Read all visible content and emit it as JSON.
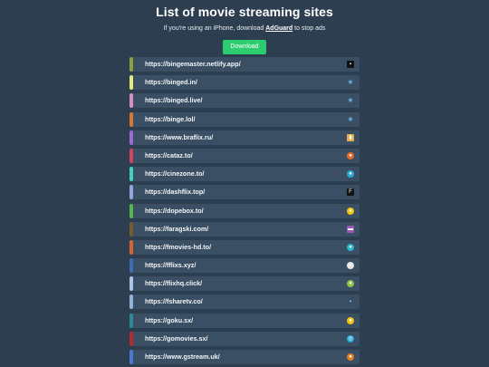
{
  "header": {
    "title": "List of movie streaming sites",
    "subtitle_prefix": "If you're using an iPhone, download ",
    "subtitle_link": "AdGuard",
    "subtitle_suffix": " to stop ads",
    "download_label": "Download"
  },
  "colors": {
    "background": "#2d3e50",
    "item_background": "#3a4f63",
    "download_button": "#2ecc71"
  },
  "sites": [
    {
      "url": "https://bingemaster.netlify.app/",
      "accent": "#8ea13a",
      "icon": "film-icon",
      "icon_bg": "#111111",
      "icon_glyph": "▪",
      "icon_shape": "square"
    },
    {
      "url": "https://binged.in/",
      "accent": "#e6e87a",
      "icon": "star-icon",
      "icon_bg": "transparent",
      "icon_glyph": "★",
      "icon_shape": "square"
    },
    {
      "url": "https://binged.live/",
      "accent": "#d98cc7",
      "icon": "star-icon",
      "icon_bg": "transparent",
      "icon_glyph": "★",
      "icon_shape": "square"
    },
    {
      "url": "https://binge.lol/",
      "accent": "#d9772e",
      "icon": "star-icon",
      "icon_bg": "transparent",
      "icon_glyph": "★",
      "icon_shape": "square"
    },
    {
      "url": "https://www.braflix.ru/",
      "accent": "#9b6ad6",
      "icon": "popcorn-icon",
      "icon_bg": "#e8b04a",
      "icon_glyph": "▮",
      "icon_shape": "square"
    },
    {
      "url": "https://cataz.to/",
      "accent": "#d6425f",
      "icon": "cataz-icon",
      "icon_bg": "#e86a2a",
      "icon_glyph": "●",
      "icon_shape": "round"
    },
    {
      "url": "https://cinezone.to/",
      "accent": "#3fd1c4",
      "icon": "cinezone-icon",
      "icon_bg": "#2aa8d6",
      "icon_glyph": "●",
      "icon_shape": "round"
    },
    {
      "url": "https://dashflix.top/",
      "accent": "#8fa6e0",
      "icon": "dashflix-icon",
      "icon_bg": "#111111",
      "icon_glyph": "F",
      "icon_shape": "square"
    },
    {
      "url": "https://dopebox.to/",
      "accent": "#52b84a",
      "icon": "dopebox-icon",
      "icon_bg": "#f1c40f",
      "icon_glyph": "●",
      "icon_shape": "round"
    },
    {
      "url": "https://faragski.com/",
      "accent": "#7a5a2a",
      "icon": "faragski-icon",
      "icon_bg": "#9b59b6",
      "icon_glyph": "▬",
      "icon_shape": "square"
    },
    {
      "url": "https://fmovies-hd.to/",
      "accent": "#d9622e",
      "icon": "fmovies-icon",
      "icon_bg": "#28b4d0",
      "icon_glyph": "●",
      "icon_shape": "round"
    },
    {
      "url": "https://fflixs.xyz/",
      "accent": "#3a6fb8",
      "icon": "fflixs-icon",
      "icon_bg": "#e8e8e8",
      "icon_glyph": "◐",
      "icon_shape": "round"
    },
    {
      "url": "https://flixhq.click/",
      "accent": "#a9c6e8",
      "icon": "flixhq-icon",
      "icon_bg": "#8bc34a",
      "icon_glyph": "●",
      "icon_shape": "round"
    },
    {
      "url": "https://fsharetv.co/",
      "accent": "#8fb3d9",
      "icon": "fsharetv-icon",
      "icon_bg": "transparent",
      "icon_glyph": "•",
      "icon_shape": "round"
    },
    {
      "url": "https://goku.sx/",
      "accent": "#2a8a9a",
      "icon": "goku-icon",
      "icon_bg": "#f1c40f",
      "icon_glyph": "●",
      "icon_shape": "round"
    },
    {
      "url": "https://gomovies.sx/",
      "accent": "#b82a2a",
      "icon": "gomovies-icon",
      "icon_bg": "#2aa8d6",
      "icon_glyph": "◎",
      "icon_shape": "round"
    },
    {
      "url": "https://www.gstream.uk/",
      "accent": "#4a7ad6",
      "icon": "gstream-icon",
      "icon_bg": "#e67e22",
      "icon_glyph": "●",
      "icon_shape": "round"
    }
  ]
}
